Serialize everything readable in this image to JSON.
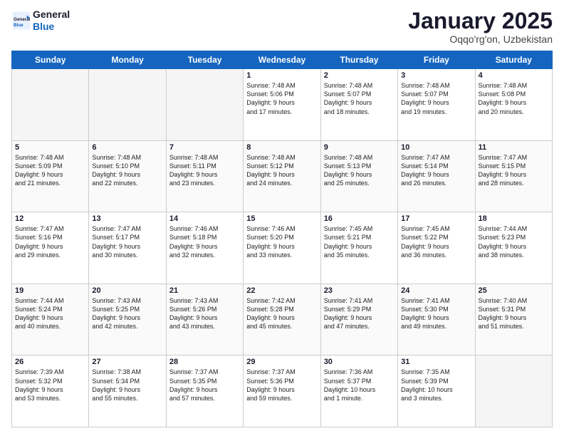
{
  "logo": {
    "line1": "General",
    "line2": "Blue"
  },
  "title": "January 2025",
  "location": "Oqqo'rg'on, Uzbekistan",
  "days_header": [
    "Sunday",
    "Monday",
    "Tuesday",
    "Wednesday",
    "Thursday",
    "Friday",
    "Saturday"
  ],
  "weeks": [
    [
      {
        "day": "",
        "content": ""
      },
      {
        "day": "",
        "content": ""
      },
      {
        "day": "",
        "content": ""
      },
      {
        "day": "1",
        "content": "Sunrise: 7:48 AM\nSunset: 5:06 PM\nDaylight: 9 hours\nand 17 minutes."
      },
      {
        "day": "2",
        "content": "Sunrise: 7:48 AM\nSunset: 5:07 PM\nDaylight: 9 hours\nand 18 minutes."
      },
      {
        "day": "3",
        "content": "Sunrise: 7:48 AM\nSunset: 5:07 PM\nDaylight: 9 hours\nand 19 minutes."
      },
      {
        "day": "4",
        "content": "Sunrise: 7:48 AM\nSunset: 5:08 PM\nDaylight: 9 hours\nand 20 minutes."
      }
    ],
    [
      {
        "day": "5",
        "content": "Sunrise: 7:48 AM\nSunset: 5:09 PM\nDaylight: 9 hours\nand 21 minutes."
      },
      {
        "day": "6",
        "content": "Sunrise: 7:48 AM\nSunset: 5:10 PM\nDaylight: 9 hours\nand 22 minutes."
      },
      {
        "day": "7",
        "content": "Sunrise: 7:48 AM\nSunset: 5:11 PM\nDaylight: 9 hours\nand 23 minutes."
      },
      {
        "day": "8",
        "content": "Sunrise: 7:48 AM\nSunset: 5:12 PM\nDaylight: 9 hours\nand 24 minutes."
      },
      {
        "day": "9",
        "content": "Sunrise: 7:48 AM\nSunset: 5:13 PM\nDaylight: 9 hours\nand 25 minutes."
      },
      {
        "day": "10",
        "content": "Sunrise: 7:47 AM\nSunset: 5:14 PM\nDaylight: 9 hours\nand 26 minutes."
      },
      {
        "day": "11",
        "content": "Sunrise: 7:47 AM\nSunset: 5:15 PM\nDaylight: 9 hours\nand 28 minutes."
      }
    ],
    [
      {
        "day": "12",
        "content": "Sunrise: 7:47 AM\nSunset: 5:16 PM\nDaylight: 9 hours\nand 29 minutes."
      },
      {
        "day": "13",
        "content": "Sunrise: 7:47 AM\nSunset: 5:17 PM\nDaylight: 9 hours\nand 30 minutes."
      },
      {
        "day": "14",
        "content": "Sunrise: 7:46 AM\nSunset: 5:18 PM\nDaylight: 9 hours\nand 32 minutes."
      },
      {
        "day": "15",
        "content": "Sunrise: 7:46 AM\nSunset: 5:20 PM\nDaylight: 9 hours\nand 33 minutes."
      },
      {
        "day": "16",
        "content": "Sunrise: 7:45 AM\nSunset: 5:21 PM\nDaylight: 9 hours\nand 35 minutes."
      },
      {
        "day": "17",
        "content": "Sunrise: 7:45 AM\nSunset: 5:22 PM\nDaylight: 9 hours\nand 36 minutes."
      },
      {
        "day": "18",
        "content": "Sunrise: 7:44 AM\nSunset: 5:23 PM\nDaylight: 9 hours\nand 38 minutes."
      }
    ],
    [
      {
        "day": "19",
        "content": "Sunrise: 7:44 AM\nSunset: 5:24 PM\nDaylight: 9 hours\nand 40 minutes."
      },
      {
        "day": "20",
        "content": "Sunrise: 7:43 AM\nSunset: 5:25 PM\nDaylight: 9 hours\nand 42 minutes."
      },
      {
        "day": "21",
        "content": "Sunrise: 7:43 AM\nSunset: 5:26 PM\nDaylight: 9 hours\nand 43 minutes."
      },
      {
        "day": "22",
        "content": "Sunrise: 7:42 AM\nSunset: 5:28 PM\nDaylight: 9 hours\nand 45 minutes."
      },
      {
        "day": "23",
        "content": "Sunrise: 7:41 AM\nSunset: 5:29 PM\nDaylight: 9 hours\nand 47 minutes."
      },
      {
        "day": "24",
        "content": "Sunrise: 7:41 AM\nSunset: 5:30 PM\nDaylight: 9 hours\nand 49 minutes."
      },
      {
        "day": "25",
        "content": "Sunrise: 7:40 AM\nSunset: 5:31 PM\nDaylight: 9 hours\nand 51 minutes."
      }
    ],
    [
      {
        "day": "26",
        "content": "Sunrise: 7:39 AM\nSunset: 5:32 PM\nDaylight: 9 hours\nand 53 minutes."
      },
      {
        "day": "27",
        "content": "Sunrise: 7:38 AM\nSunset: 5:34 PM\nDaylight: 9 hours\nand 55 minutes."
      },
      {
        "day": "28",
        "content": "Sunrise: 7:37 AM\nSunset: 5:35 PM\nDaylight: 9 hours\nand 57 minutes."
      },
      {
        "day": "29",
        "content": "Sunrise: 7:37 AM\nSunset: 5:36 PM\nDaylight: 9 hours\nand 59 minutes."
      },
      {
        "day": "30",
        "content": "Sunrise: 7:36 AM\nSunset: 5:37 PM\nDaylight: 10 hours\nand 1 minute."
      },
      {
        "day": "31",
        "content": "Sunrise: 7:35 AM\nSunset: 5:39 PM\nDaylight: 10 hours\nand 3 minutes."
      },
      {
        "day": "",
        "content": ""
      }
    ]
  ]
}
